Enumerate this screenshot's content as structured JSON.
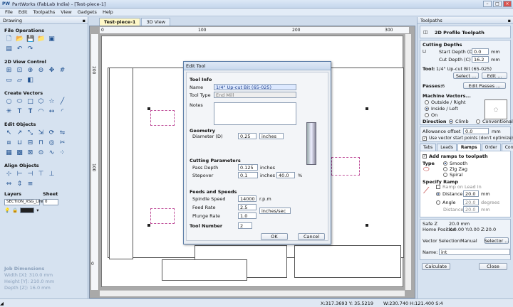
{
  "window": {
    "logo": "PW",
    "title": "PartWorks (FabLab India) - [Test-piece-1]"
  },
  "menu": [
    "File",
    "Edit",
    "Toolpaths",
    "View",
    "Gadgets",
    "Help"
  ],
  "left_panel": {
    "header": "Drawing",
    "sections": [
      "File Operations",
      "2D View Control",
      "Create Vectors",
      "Edit Objects",
      "Align Objects"
    ],
    "layers_label": "Layers",
    "sheet_label": "Sheet",
    "layer_value": "SECTION_XSG_LINE",
    "sheet_value": "0",
    "job_dims_title": "Job Dimensions",
    "job_width": "Width  [X]: 310.0 mm",
    "job_height": "Height [Y]: 210.0 mm",
    "job_depth": "Depth  [Z]: 16.0 mm"
  },
  "doc_tabs": [
    "Test-piece-1",
    "3D View"
  ],
  "rulers": {
    "top": [
      "0",
      "100",
      "200",
      "300"
    ],
    "left": [
      "200",
      "100",
      "0"
    ]
  },
  "status": {
    "xy": "X:317.3693 Y: 35.5219",
    "wh": "W:230.740  H:121.400  S:4"
  },
  "right_panel": {
    "header": "Toolpaths",
    "title": "2D Profile Toolpath",
    "cutting_depths": "Cutting Depths",
    "start_depth_label": "Start Depth (D)",
    "start_depth": "0.0",
    "cut_depth_label": "Cut Depth (C)",
    "cut_depth": "16.2",
    "unit": "mm",
    "tool_label": "Tool:",
    "tool_value": "1/4\" Up-cut Bit (65-025)",
    "select_btn": "Select ...",
    "edit_btn": "Edit ...",
    "passes_label": "Passes:",
    "passes": "6",
    "edit_passes_btn": "Edit Passes ...",
    "machine_vectors": "Machine Vectors...",
    "mv_options": [
      "Outside / Right",
      "Inside / Left",
      "On"
    ],
    "direction_label": "Direction",
    "climb": "Climb",
    "conventional": "Conventional",
    "allowance_label": "Allowance offset",
    "allowance": "0.0",
    "use_start_points": "Use vector start points (don't optimize)",
    "tabs": [
      "Tabs",
      "Leads",
      "Ramps",
      "Order",
      "Corners"
    ],
    "add_ramps": "Add ramps to toolpath",
    "type_label": "Type",
    "ramp_types": [
      "Smooth",
      "Zig Zag",
      "Spiral"
    ],
    "specify_ramp": "Specify Ramp",
    "ramp_on_lead_in": "Ramp on Lead In",
    "distance_label": "Distance",
    "distance": "20.0",
    "angle_label": "Angle",
    "angle": "20.0",
    "degrees": "degrees",
    "distance2": "20.0",
    "safe_z": "Safe Z",
    "safe_z_val": "20.0 mm",
    "home_pos": "Home Position",
    "home_val": "X:0.00 Y:0.00 Z:20.0",
    "vector_sel_label": "Vector Selection:",
    "vector_sel_val": "Manual",
    "selector_btn": "Selector ...",
    "name_label": "Name:",
    "name_val": "int",
    "calculate_btn": "Calculate",
    "close_btn": "Close"
  },
  "dialog": {
    "title": "Edit Tool",
    "tool_info": "Tool Info",
    "name_label": "Name",
    "name_val": "1/4\" Up-cut Bit (65-025)",
    "tool_type_label": "Tool Type",
    "tool_type_val": "End Mill",
    "notes_label": "Notes",
    "geometry": "Geometry",
    "diameter_label": "Diameter (D)",
    "diameter": "0.25",
    "units": "inches",
    "cutting_params": "Cutting Parameters",
    "pass_depth_label": "Pass Depth",
    "pass_depth": "0.125",
    "stepover_label": "Stepover",
    "stepover": "0.1",
    "stepover_pct": "40.0",
    "pct": "%",
    "feeds_speeds": "Feeds and Speeds",
    "spindle_label": "Spindle Speed",
    "spindle": "14000",
    "rpm": "r.p.m",
    "feed_label": "Feed Rate",
    "feed": "2.5",
    "feed_units": "inches/sec",
    "plunge_label": "Plunge Rate",
    "plunge": "1.0",
    "tool_number_label": "Tool Number",
    "tool_number": "2",
    "ok": "OK",
    "cancel": "Cancel"
  }
}
